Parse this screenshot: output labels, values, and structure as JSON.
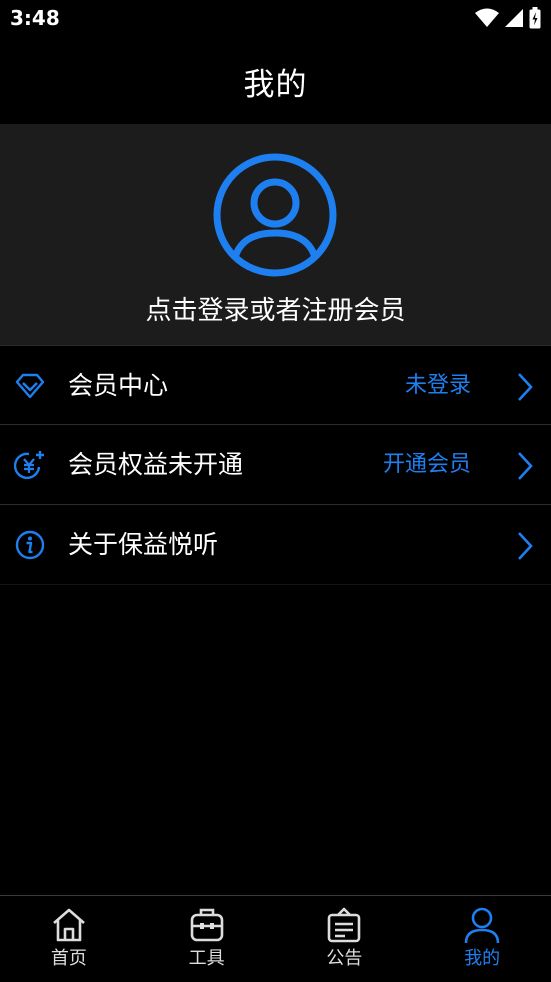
{
  "status_bar": {
    "time": "3:48",
    "icons": [
      "wifi-icon",
      "signal-icon",
      "battery-icon"
    ]
  },
  "header": {
    "title": "我的"
  },
  "profile": {
    "avatar_icon": "user-avatar-icon",
    "login_text": "点击登录或者注册会员"
  },
  "menu": {
    "items": [
      {
        "icon": "diamond-icon",
        "label": "会员中心",
        "value": "未登录"
      },
      {
        "icon": "yen-plus-icon",
        "label": "会员权益未开通",
        "value": "开通会员"
      },
      {
        "icon": "info-icon",
        "label": "关于保益悦听",
        "value": ""
      }
    ]
  },
  "tabbar": {
    "tabs": [
      {
        "icon": "home-icon",
        "label": "首页",
        "active": false
      },
      {
        "icon": "toolbox-icon",
        "label": "工具",
        "active": false
      },
      {
        "icon": "notice-board-icon",
        "label": "公告",
        "active": false
      },
      {
        "icon": "user-icon",
        "label": "我的",
        "active": true
      }
    ]
  },
  "colors": {
    "accent": "#1e7ff0",
    "background": "#000000",
    "profile_background": "#1c1c1c",
    "divider": "#2c2c2c"
  }
}
